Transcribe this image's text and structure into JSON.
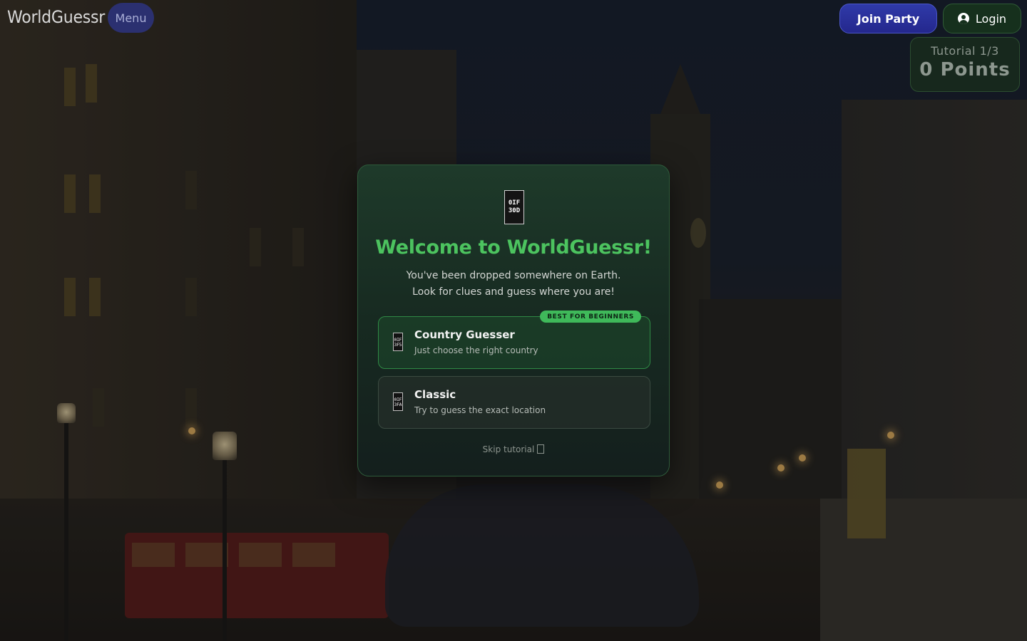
{
  "brand": {
    "name": "WorldGuessr"
  },
  "topbar": {
    "menu_label": "Menu",
    "join_party_label": "Join Party",
    "login_label": "Login"
  },
  "score": {
    "tutorial_label": "Tutorial 1/3",
    "points_label": "0 Points"
  },
  "modal": {
    "icon_text": "0IF 30D",
    "title": "Welcome to WorldGuessr!",
    "subtitle_line1": "You've been dropped somewhere on Earth.",
    "subtitle_line2": "Look for clues and guess where you are!",
    "options": [
      {
        "name": "Country Guesser",
        "description": "Just choose the right country",
        "badge": "BEST FOR BEGINNERS",
        "icon_text": "0IF 3F5"
      },
      {
        "name": "Classic",
        "description": "Try to guess the exact location",
        "icon_text": "0IF 3FA"
      }
    ],
    "skip_label": "Skip tutorial"
  },
  "colors": {
    "accent_green": "#4cc35f",
    "badge_green": "#3fb95a",
    "join_blue": "#2f3aa8",
    "login_green": "#16301d"
  },
  "icons": [
    "user-icon",
    "globe-icon",
    "country-mode-icon",
    "classic-mode-icon",
    "arrow-icon"
  ]
}
